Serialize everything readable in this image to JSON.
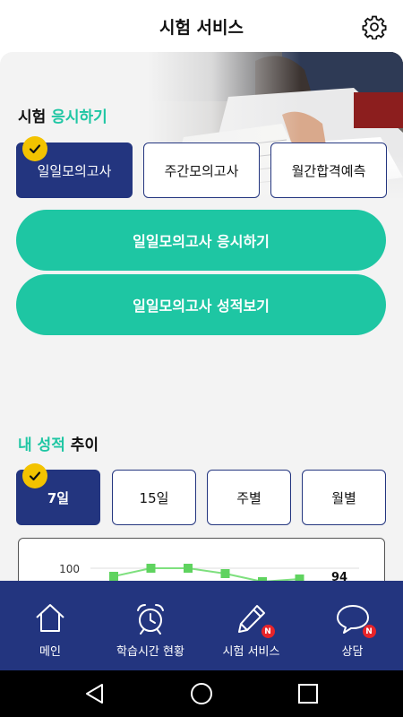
{
  "header": {
    "title": "시험 서비스",
    "settings_icon": "gear-icon"
  },
  "exam_section": {
    "title_prefix": "시험",
    "title_accent": "응시하기",
    "tabs": [
      {
        "label": "일일모의고사",
        "active": true
      },
      {
        "label": "주간모의고사",
        "active": false
      },
      {
        "label": "월간합격예측",
        "active": false
      }
    ],
    "primary_button": "일일모의고사 응시하기",
    "secondary_button": "일일모의고사 성적보기"
  },
  "score_section": {
    "title_accent": "내 성적",
    "title_suffix": "추이",
    "tabs": [
      {
        "label": "7일",
        "active": true
      },
      {
        "label": "15일",
        "active": false
      },
      {
        "label": "주별",
        "active": false
      },
      {
        "label": "월별",
        "active": false
      }
    ]
  },
  "chart_data": {
    "type": "line",
    "ytick_labels": [
      "100"
    ],
    "values": [
      97,
      100,
      100,
      98,
      95,
      96
    ],
    "data_labels": [
      "94"
    ],
    "colors": {
      "line": "#7ee07e",
      "marker": "#5fd35f"
    }
  },
  "bottom_nav": {
    "items": [
      {
        "label": "메인",
        "icon": "home-icon"
      },
      {
        "label": "학습시간 현황",
        "icon": "alarm-clock-icon"
      },
      {
        "label": "시험 서비스",
        "icon": "pen-icon",
        "badge": "N"
      },
      {
        "label": "상담",
        "icon": "chat-bubble-icon",
        "badge": "N"
      }
    ]
  },
  "colors": {
    "accent": "#1ec6a3",
    "primary": "#23357f",
    "check": "#f3c300",
    "badge": "#e8242a"
  }
}
